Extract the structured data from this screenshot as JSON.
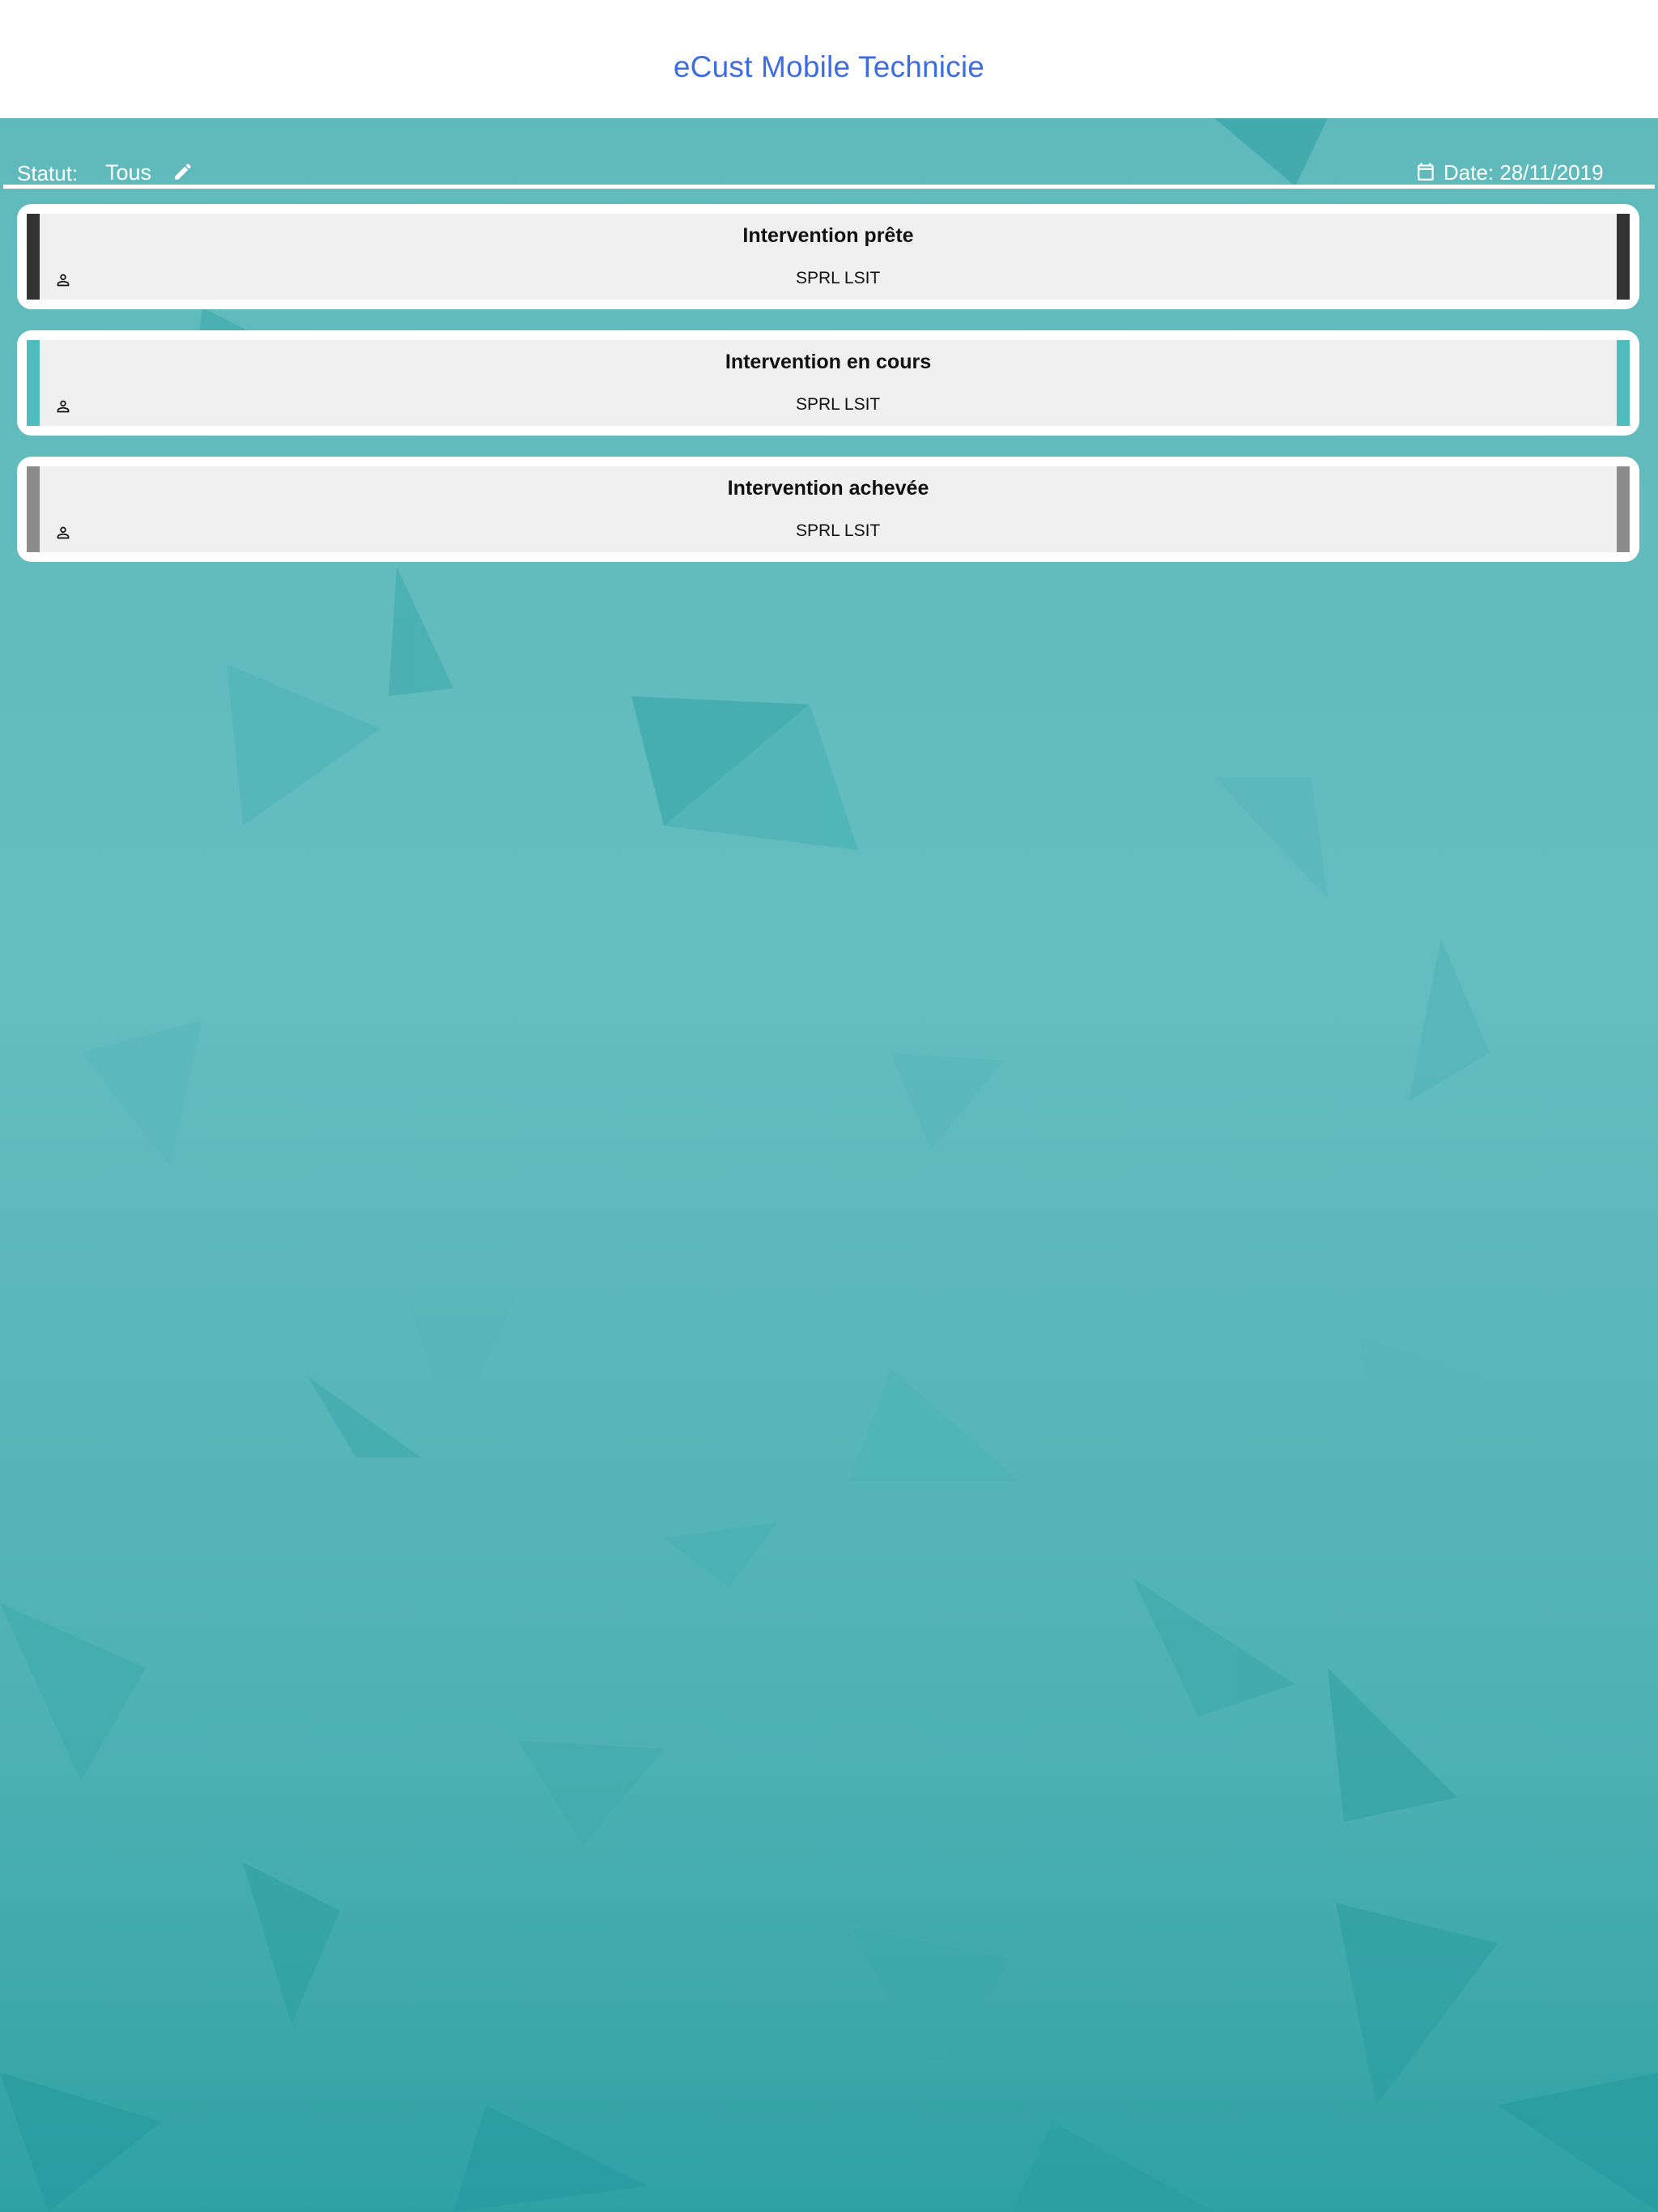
{
  "app": {
    "title": "eCust Mobile Technicie"
  },
  "filter": {
    "status_label": "Statut:",
    "status_value": "Tous",
    "edit_icon": "pencil-icon",
    "date_icon": "calendar-icon",
    "date_text": "Date: 28/11/2019"
  },
  "interventions": [
    {
      "title": "Intervention prête",
      "client": "SPRL LSIT",
      "status_color": "#333333"
    },
    {
      "title": "Intervention en cours",
      "client": "SPRL LSIT",
      "status_color": "#4fbdbe"
    },
    {
      "title": "Intervention achevée",
      "client": "SPRL LSIT",
      "status_color": "#8c8c8c"
    }
  ],
  "colors": {
    "header_background": "#ffffff",
    "title_color": "#3d6de0",
    "page_background": "#5fbabd",
    "card_background": "#f0f0f0"
  }
}
